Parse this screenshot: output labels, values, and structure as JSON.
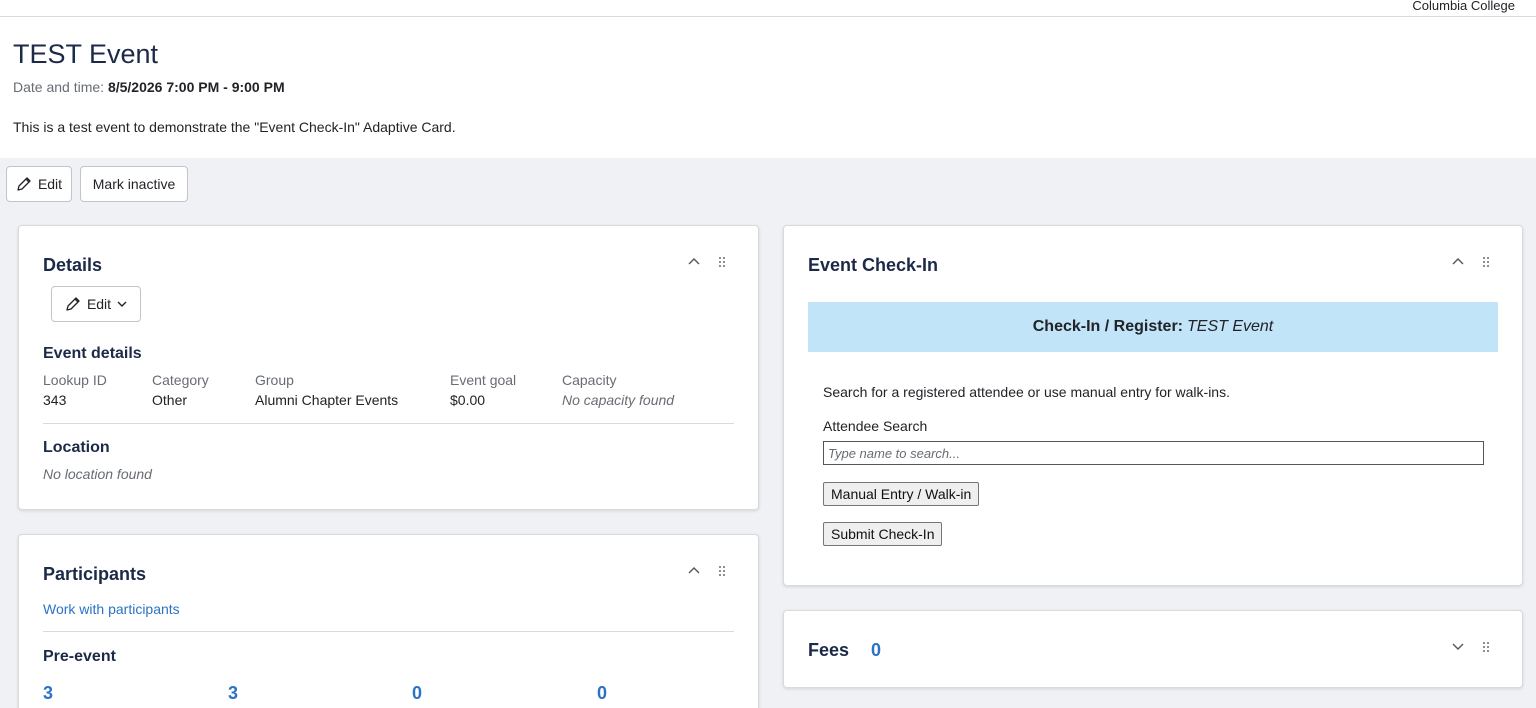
{
  "topbar": {
    "org": "Columbia College"
  },
  "event": {
    "title": "TEST Event",
    "datetime_label": "Date and time:",
    "datetime_value": "8/5/2026 7:00 PM - 9:00 PM",
    "description": "This is a test event to demonstrate the \"Event Check-In\" Adaptive Card."
  },
  "actions": {
    "edit": "Edit",
    "mark_inactive": "Mark inactive"
  },
  "details": {
    "title": "Details",
    "edit": "Edit",
    "event_details_heading": "Event details",
    "fields": [
      {
        "label": "Lookup ID",
        "value": "343"
      },
      {
        "label": "Category",
        "value": "Other"
      },
      {
        "label": "Group",
        "value": "Alumni Chapter Events"
      },
      {
        "label": "Event goal",
        "value": "$0.00"
      },
      {
        "label": "Capacity",
        "value": "No capacity found"
      }
    ],
    "location_heading": "Location",
    "location_value": "No location found"
  },
  "participants": {
    "title": "Participants",
    "link": "Work with participants",
    "pre_event_heading": "Pre-event",
    "counts": [
      "3",
      "3",
      "0",
      "0"
    ]
  },
  "checkin": {
    "title": "Event Check-In",
    "banner_bold": "Check-In / Register:",
    "banner_event": "TEST Event",
    "instructions": "Search for a registered attendee or use manual entry for walk-ins.",
    "search_label": "Attendee Search",
    "search_placeholder": "Type name to search...",
    "manual_button": "Manual Entry / Walk-in",
    "submit_button": "Submit Check-In"
  },
  "fees": {
    "title": "Fees",
    "count": "0"
  },
  "colors": {
    "accent": "#2a73c5",
    "title": "#1c2a47",
    "banner": "#c2e4f8",
    "background": "#f0f1f4"
  },
  "icons": {
    "collapse": "chevron-up-icon",
    "expand": "chevron-down-icon",
    "drag": "drag-handle-icon",
    "edit": "pencil-icon"
  }
}
